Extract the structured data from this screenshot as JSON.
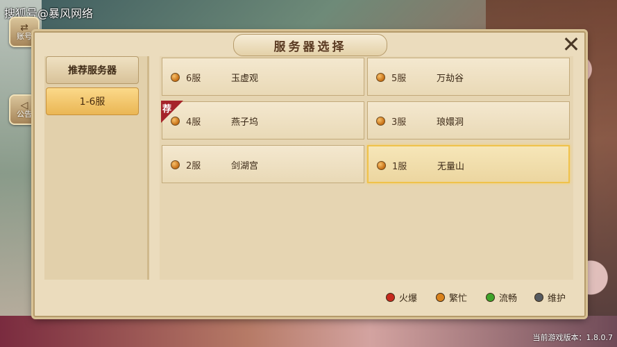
{
  "watermark": "搜狐号@暴风网络",
  "side_buttons": [
    {
      "label": "账号",
      "icon": "switch-arrows-icon"
    },
    {
      "label": "公告",
      "icon": "megaphone-icon"
    }
  ],
  "dialog": {
    "title": "服务器选择",
    "close_glyph": "✕"
  },
  "categories": [
    {
      "label": "推荐服务器",
      "selected": false
    },
    {
      "label": "1-6服",
      "selected": true
    }
  ],
  "servers": [
    {
      "num": "6服",
      "name": "玉虚观",
      "status": "busy",
      "recommended": false,
      "selected": false
    },
    {
      "num": "5服",
      "name": "万劫谷",
      "status": "busy",
      "recommended": false,
      "selected": false
    },
    {
      "num": "4服",
      "name": "燕子坞",
      "status": "busy",
      "recommended": true,
      "selected": false
    },
    {
      "num": "3服",
      "name": "琅嬛洞",
      "status": "busy",
      "recommended": false,
      "selected": false
    },
    {
      "num": "2服",
      "name": "剑湖宫",
      "status": "busy",
      "recommended": false,
      "selected": false
    },
    {
      "num": "1服",
      "name": "无量山",
      "status": "busy",
      "recommended": false,
      "selected": true
    }
  ],
  "recommend_tag": "荐",
  "legend": [
    {
      "label": "火爆",
      "color": "#c62a1e"
    },
    {
      "label": "繁忙",
      "color": "#d9821c"
    },
    {
      "label": "流畅",
      "color": "#3fa32a"
    },
    {
      "label": "维护",
      "color": "#555a60"
    }
  ],
  "version_text": "当前游戏版本：1.8.0.7"
}
